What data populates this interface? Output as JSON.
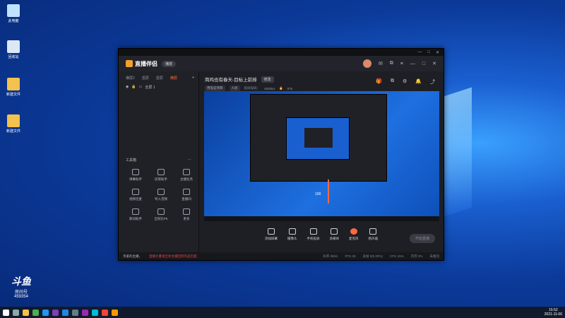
{
  "desktop": {
    "icons": [
      {
        "label": "此电脑"
      },
      {
        "label": "回收站"
      },
      {
        "label": "新建文件"
      },
      {
        "label": "新建文件"
      }
    ]
  },
  "app": {
    "title": "直播伴侣",
    "version_pill": "播放",
    "left_tabs": [
      "横屏2",
      "竖屏",
      "竖屏",
      "横屏"
    ],
    "active_tab_index": 3,
    "scene_label": "全屏 1",
    "tools_title": "工具箱",
    "tools": [
      {
        "label": "弹幕助手",
        "icon": "danmaku-icon"
      },
      {
        "label": "房管助手",
        "icon": "admin-icon"
      },
      {
        "label": "主播任务",
        "icon": "task-icon"
      },
      {
        "label": "视频连麦",
        "icon": "video-link-icon"
      },
      {
        "label": "导入音频",
        "icon": "import-icon"
      },
      {
        "label": "直播间",
        "icon": "room-icon"
      },
      {
        "label": "歌词助手",
        "icon": "lyrics-icon"
      },
      {
        "label": "全民比PK",
        "icon": "pk-icon"
      },
      {
        "label": "更多",
        "icon": "more-icon"
      }
    ],
    "stream_title": "简鸡也有春天-目标上前排",
    "edit_label": "修改",
    "category_label": "用电竞项目",
    "category_tag": "人民",
    "room_prefix": "房间号码：",
    "room_number": "459354",
    "fire_count": "976",
    "volume_value": "100",
    "volume_level": 1.0,
    "bottom_controls": [
      {
        "label": "添加屏幕",
        "icon": "screen-add-icon"
      },
      {
        "label": "摄像头",
        "icon": "camera-icon"
      },
      {
        "label": "手机投屏",
        "icon": "phone-cast-icon"
      },
      {
        "label": "多媒体",
        "icon": "media-icon"
      },
      {
        "label": "麦克风",
        "icon": "mic-icon"
      },
      {
        "label": "扬声器",
        "icon": "speaker-icon"
      }
    ],
    "start_button": "开始直播",
    "status_notice": "亲爱的主播，",
    "status_warning": "直播大厦请全体主播回到作品页面",
    "status_right": [
      "码率 0kb/s",
      "FPS 30",
      "丢帧 0(0.00%)",
      "CPU 15%",
      "内存 0%",
      "未推流"
    ]
  },
  "watermark": {
    "brand": "斗鱼",
    "sub": "房间号",
    "room": "459354"
  },
  "taskbar": {
    "time": "15:52",
    "date": "2021-11-06"
  }
}
